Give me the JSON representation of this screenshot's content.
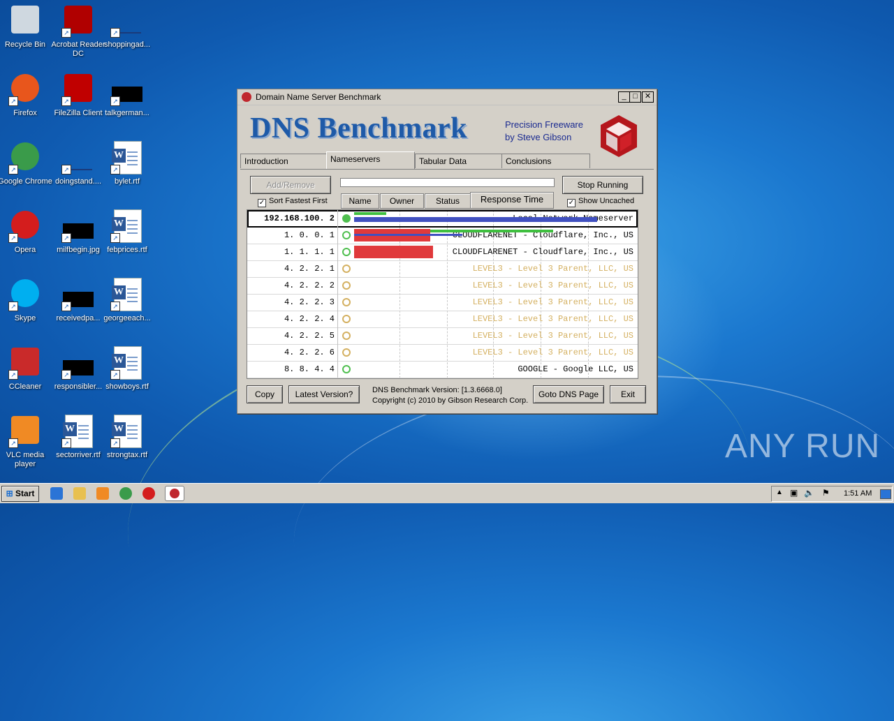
{
  "desktop": {
    "icons": [
      {
        "label": "Recycle Bin",
        "icon": "recycle-bin-icon"
      },
      {
        "label": "Acrobat Reader DC",
        "icon": "acrobat-icon"
      },
      {
        "label": "shoppingad...",
        "icon": "file-icon"
      },
      {
        "label": "Firefox",
        "icon": "firefox-icon"
      },
      {
        "label": "FileZilla Client",
        "icon": "filezilla-icon"
      },
      {
        "label": "talkgerman...",
        "icon": "file-icon"
      },
      {
        "label": "Google Chrome",
        "icon": "chrome-icon"
      },
      {
        "label": "doingstand....",
        "icon": "file-icon"
      },
      {
        "label": "bylet.rtf",
        "icon": "word-icon"
      },
      {
        "label": "Opera",
        "icon": "opera-icon"
      },
      {
        "label": "milfbegin.jpg",
        "icon": "file-icon"
      },
      {
        "label": "febprices.rtf",
        "icon": "word-icon"
      },
      {
        "label": "Skype",
        "icon": "skype-icon"
      },
      {
        "label": "receivedpa...",
        "icon": "file-icon"
      },
      {
        "label": "georgeeach...",
        "icon": "word-icon"
      },
      {
        "label": "CCleaner",
        "icon": "ccleaner-icon"
      },
      {
        "label": "responsibler...",
        "icon": "file-icon"
      },
      {
        "label": "showboys.rtf",
        "icon": "word-icon"
      },
      {
        "label": "VLC media player",
        "icon": "vlc-icon"
      },
      {
        "label": "sectorriver.rtf",
        "icon": "word-icon"
      },
      {
        "label": "strongtax.rtf",
        "icon": "word-icon"
      }
    ],
    "watermark": "ANY RUN"
  },
  "window": {
    "title": "Domain Name Server Benchmark",
    "brand": "DNS Benchmark",
    "tagline1": "Precision Freeware",
    "tagline2": "by Steve Gibson",
    "tabs": [
      "Introduction",
      "Nameservers",
      "Tabular Data",
      "Conclusions"
    ],
    "active_tab": "Nameservers",
    "buttons": {
      "add_remove": "Add/Remove",
      "stop": "Stop Running",
      "copy": "Copy",
      "latest": "Latest Version?",
      "goto": "Goto DNS Page",
      "exit": "Exit"
    },
    "checkboxes": {
      "sort": "Sort Fastest First",
      "uncached": "Show Uncached"
    },
    "columns": [
      "Name",
      "Owner",
      "Status",
      "Response Time"
    ],
    "rows": [
      {
        "ip": "192.168.100.  2",
        "owner": "Local Network Nameserver",
        "status": "ok",
        "cached": 0.13,
        "uncached": 0.99,
        "dotcom": 0.05
      },
      {
        "ip": "1.   0.   0.   1",
        "owner": "CLOUDFLARENET - Cloudflare, Inc., US",
        "status": "ok",
        "cached": 0.31,
        "uncached": 0.81,
        "dotcom": 0.44
      },
      {
        "ip": "1.   1.   1.   1",
        "owner": "CLOUDFLARENET - Cloudflare, Inc., US",
        "status": "ok",
        "cached": 0.32,
        "uncached": 0,
        "dotcom": 0
      },
      {
        "ip": "4.   2.   2.   1",
        "owner": "LEVEL3 - Level 3 Parent, LLC, US",
        "status": "pending"
      },
      {
        "ip": "4.   2.   2.   2",
        "owner": "LEVEL3 - Level 3 Parent, LLC, US",
        "status": "pending"
      },
      {
        "ip": "4.   2.   2.   3",
        "owner": "LEVEL3 - Level 3 Parent, LLC, US",
        "status": "pending"
      },
      {
        "ip": "4.   2.   2.   4",
        "owner": "LEVEL3 - Level 3 Parent, LLC, US",
        "status": "pending"
      },
      {
        "ip": "4.   2.   2.   5",
        "owner": "LEVEL3 - Level 3 Parent, LLC, US",
        "status": "pending"
      },
      {
        "ip": "4.   2.   2.   6",
        "owner": "LEVEL3 - Level 3 Parent, LLC, US",
        "status": "pending"
      },
      {
        "ip": "8.   8.   4.   4",
        "owner": "GOOGLE - Google LLC, US",
        "status": "ok-pending"
      }
    ],
    "version": "DNS Benchmark Version: [1.3.6668.0]",
    "copyright": "Copyright (c) 2010 by Gibson Research Corp.",
    "colors": {
      "cached": "#e0393b",
      "uncached": "#3fbf3f",
      "dotcom": "#4050c0",
      "pending_text": "#d4b060"
    }
  },
  "taskbar": {
    "start": "Start",
    "clock": "1:51 AM"
  }
}
